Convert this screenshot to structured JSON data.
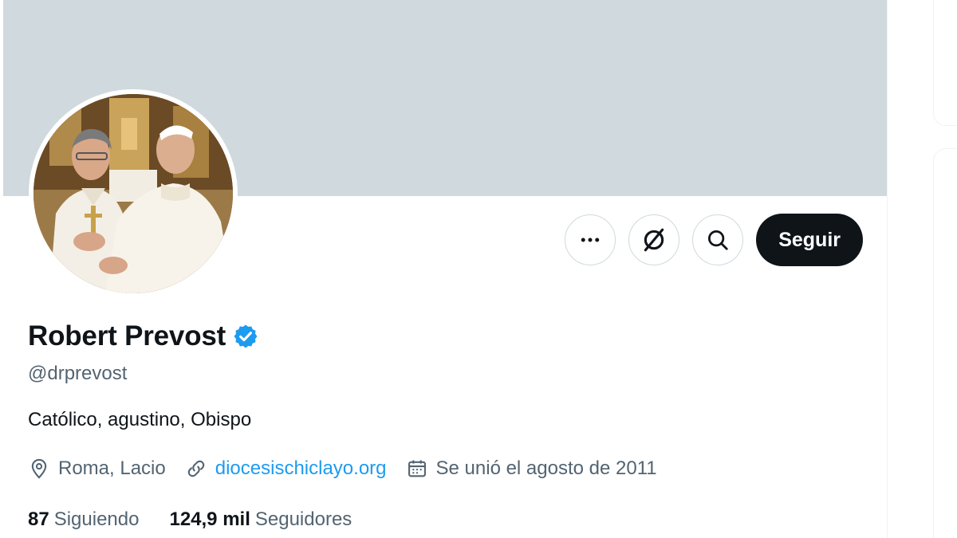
{
  "profile": {
    "display_name": "Robert Prevost",
    "verified": true,
    "handle": "@drprevost",
    "bio": "Católico, agustino, Obispo",
    "location": "Roma, Lacio",
    "website": "diocesischiclayo.org",
    "joined": "Se unió el agosto de 2011",
    "following_count": "87",
    "following_label": "Siguiendo",
    "followers_count": "124,9 mil",
    "followers_label": "Seguidores"
  },
  "actions": {
    "more_icon": "more-horizontal-icon",
    "grok_icon": "grok-icon",
    "search_icon": "search-icon",
    "follow_label": "Seguir"
  },
  "colors": {
    "banner": "#cfd9de",
    "accent": "#1d9bf0",
    "text_primary": "#0f1419",
    "text_secondary": "#536471",
    "follow_bg": "#0f1419"
  }
}
